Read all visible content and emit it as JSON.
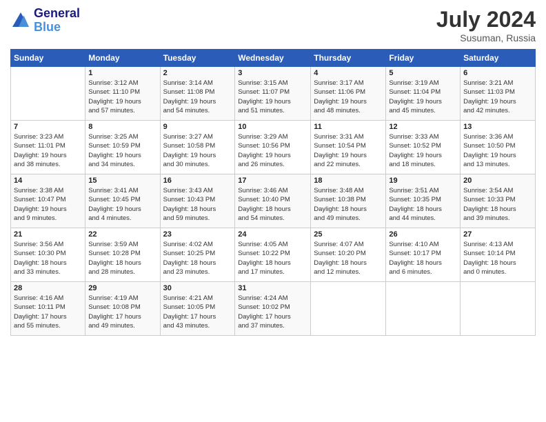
{
  "header": {
    "logo_line1": "General",
    "logo_line2": "Blue",
    "month_year": "July 2024",
    "location": "Susuman, Russia"
  },
  "weekdays": [
    "Sunday",
    "Monday",
    "Tuesday",
    "Wednesday",
    "Thursday",
    "Friday",
    "Saturday"
  ],
  "weeks": [
    [
      {
        "day": "",
        "info": ""
      },
      {
        "day": "1",
        "info": "Sunrise: 3:12 AM\nSunset: 11:10 PM\nDaylight: 19 hours\nand 57 minutes."
      },
      {
        "day": "2",
        "info": "Sunrise: 3:14 AM\nSunset: 11:08 PM\nDaylight: 19 hours\nand 54 minutes."
      },
      {
        "day": "3",
        "info": "Sunrise: 3:15 AM\nSunset: 11:07 PM\nDaylight: 19 hours\nand 51 minutes."
      },
      {
        "day": "4",
        "info": "Sunrise: 3:17 AM\nSunset: 11:06 PM\nDaylight: 19 hours\nand 48 minutes."
      },
      {
        "day": "5",
        "info": "Sunrise: 3:19 AM\nSunset: 11:04 PM\nDaylight: 19 hours\nand 45 minutes."
      },
      {
        "day": "6",
        "info": "Sunrise: 3:21 AM\nSunset: 11:03 PM\nDaylight: 19 hours\nand 42 minutes."
      }
    ],
    [
      {
        "day": "7",
        "info": "Sunrise: 3:23 AM\nSunset: 11:01 PM\nDaylight: 19 hours\nand 38 minutes."
      },
      {
        "day": "8",
        "info": "Sunrise: 3:25 AM\nSunset: 10:59 PM\nDaylight: 19 hours\nand 34 minutes."
      },
      {
        "day": "9",
        "info": "Sunrise: 3:27 AM\nSunset: 10:58 PM\nDaylight: 19 hours\nand 30 minutes."
      },
      {
        "day": "10",
        "info": "Sunrise: 3:29 AM\nSunset: 10:56 PM\nDaylight: 19 hours\nand 26 minutes."
      },
      {
        "day": "11",
        "info": "Sunrise: 3:31 AM\nSunset: 10:54 PM\nDaylight: 19 hours\nand 22 minutes."
      },
      {
        "day": "12",
        "info": "Sunrise: 3:33 AM\nSunset: 10:52 PM\nDaylight: 19 hours\nand 18 minutes."
      },
      {
        "day": "13",
        "info": "Sunrise: 3:36 AM\nSunset: 10:50 PM\nDaylight: 19 hours\nand 13 minutes."
      }
    ],
    [
      {
        "day": "14",
        "info": "Sunrise: 3:38 AM\nSunset: 10:47 PM\nDaylight: 19 hours\nand 9 minutes."
      },
      {
        "day": "15",
        "info": "Sunrise: 3:41 AM\nSunset: 10:45 PM\nDaylight: 19 hours\nand 4 minutes."
      },
      {
        "day": "16",
        "info": "Sunrise: 3:43 AM\nSunset: 10:43 PM\nDaylight: 18 hours\nand 59 minutes."
      },
      {
        "day": "17",
        "info": "Sunrise: 3:46 AM\nSunset: 10:40 PM\nDaylight: 18 hours\nand 54 minutes."
      },
      {
        "day": "18",
        "info": "Sunrise: 3:48 AM\nSunset: 10:38 PM\nDaylight: 18 hours\nand 49 minutes."
      },
      {
        "day": "19",
        "info": "Sunrise: 3:51 AM\nSunset: 10:35 PM\nDaylight: 18 hours\nand 44 minutes."
      },
      {
        "day": "20",
        "info": "Sunrise: 3:54 AM\nSunset: 10:33 PM\nDaylight: 18 hours\nand 39 minutes."
      }
    ],
    [
      {
        "day": "21",
        "info": "Sunrise: 3:56 AM\nSunset: 10:30 PM\nDaylight: 18 hours\nand 33 minutes."
      },
      {
        "day": "22",
        "info": "Sunrise: 3:59 AM\nSunset: 10:28 PM\nDaylight: 18 hours\nand 28 minutes."
      },
      {
        "day": "23",
        "info": "Sunrise: 4:02 AM\nSunset: 10:25 PM\nDaylight: 18 hours\nand 23 minutes."
      },
      {
        "day": "24",
        "info": "Sunrise: 4:05 AM\nSunset: 10:22 PM\nDaylight: 18 hours\nand 17 minutes."
      },
      {
        "day": "25",
        "info": "Sunrise: 4:07 AM\nSunset: 10:20 PM\nDaylight: 18 hours\nand 12 minutes."
      },
      {
        "day": "26",
        "info": "Sunrise: 4:10 AM\nSunset: 10:17 PM\nDaylight: 18 hours\nand 6 minutes."
      },
      {
        "day": "27",
        "info": "Sunrise: 4:13 AM\nSunset: 10:14 PM\nDaylight: 18 hours\nand 0 minutes."
      }
    ],
    [
      {
        "day": "28",
        "info": "Sunrise: 4:16 AM\nSunset: 10:11 PM\nDaylight: 17 hours\nand 55 minutes."
      },
      {
        "day": "29",
        "info": "Sunrise: 4:19 AM\nSunset: 10:08 PM\nDaylight: 17 hours\nand 49 minutes."
      },
      {
        "day": "30",
        "info": "Sunrise: 4:21 AM\nSunset: 10:05 PM\nDaylight: 17 hours\nand 43 minutes."
      },
      {
        "day": "31",
        "info": "Sunrise: 4:24 AM\nSunset: 10:02 PM\nDaylight: 17 hours\nand 37 minutes."
      },
      {
        "day": "",
        "info": ""
      },
      {
        "day": "",
        "info": ""
      },
      {
        "day": "",
        "info": ""
      }
    ]
  ]
}
